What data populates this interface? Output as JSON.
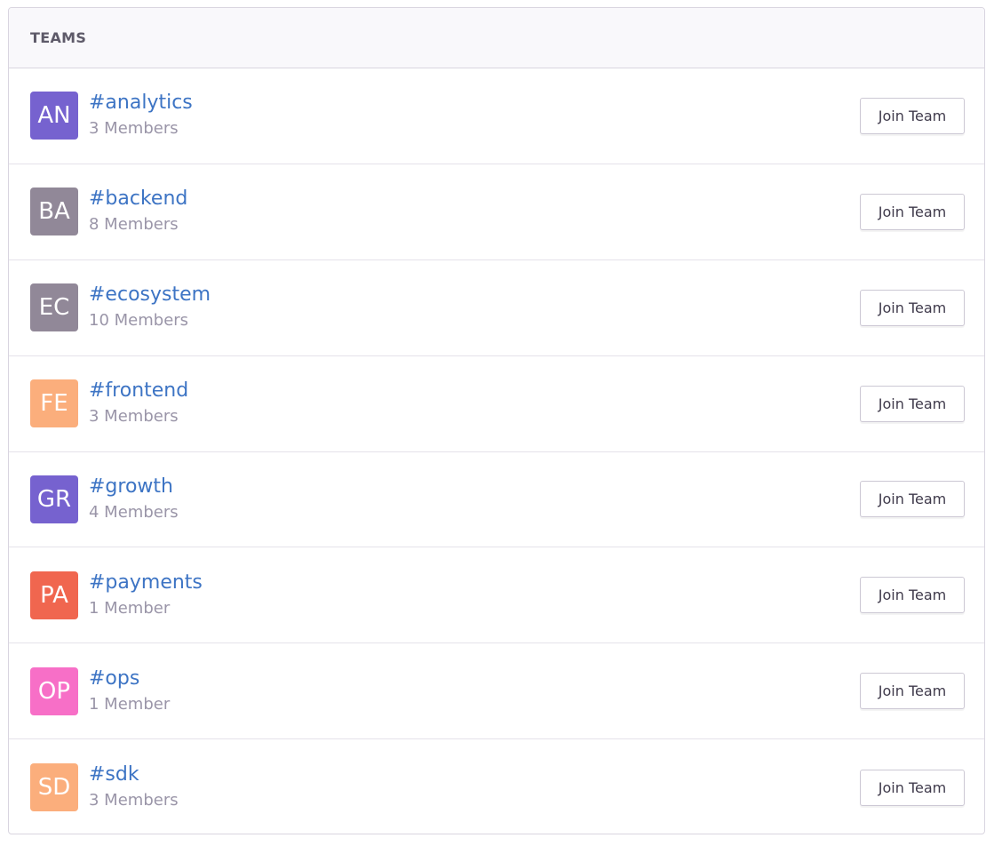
{
  "header": {
    "title": "TEAMS"
  },
  "teams": [
    {
      "initials": "AN",
      "name": "#analytics",
      "members": "3 Members",
      "color": "#7662cf",
      "button": "Join Team"
    },
    {
      "initials": "BA",
      "name": "#backend",
      "members": "8 Members",
      "color": "#918898",
      "button": "Join Team"
    },
    {
      "initials": "EC",
      "name": "#ecosystem",
      "members": "10 Members",
      "color": "#918898",
      "button": "Join Team"
    },
    {
      "initials": "FE",
      "name": "#frontend",
      "members": "3 Members",
      "color": "#fbae7c",
      "button": "Join Team"
    },
    {
      "initials": "GR",
      "name": "#growth",
      "members": "4 Members",
      "color": "#7662cf",
      "button": "Join Team"
    },
    {
      "initials": "PA",
      "name": "#payments",
      "members": "1 Member",
      "color": "#f0664f",
      "button": "Join Team"
    },
    {
      "initials": "OP",
      "name": "#ops",
      "members": "1 Member",
      "color": "#f76fc7",
      "button": "Join Team"
    },
    {
      "initials": "SD",
      "name": "#sdk",
      "members": "3 Members",
      "color": "#fbae7c",
      "button": "Join Team"
    }
  ]
}
